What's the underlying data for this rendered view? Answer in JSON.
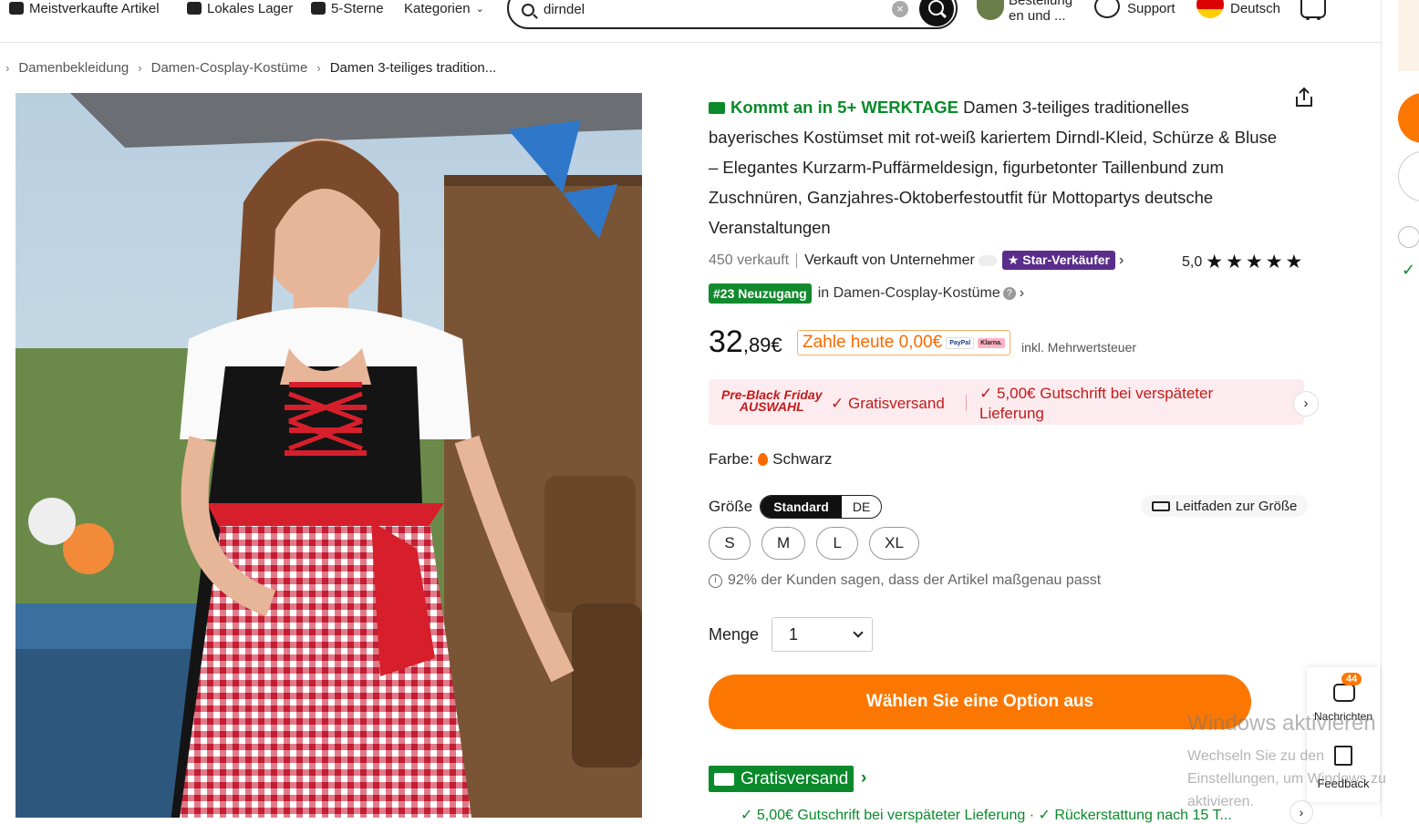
{
  "topnav": {
    "bestsellers": "Meistverkaufte Artikel",
    "local_warehouse": "Lokales Lager",
    "five_stars": "5-Sterne",
    "categories": "Kategorien",
    "order_line1": "Bestellung",
    "order_line2": "en und ...",
    "support": "Support",
    "language": "Deutsch"
  },
  "search": {
    "value": "dirndel",
    "clear": "×"
  },
  "breadcrumb": [
    "Damenbekleidung",
    "Damen-Cosplay-Kostüme",
    "Damen 3-teiliges tradition..."
  ],
  "product": {
    "delivery": "Kommt an in 5+ WERKTAGE",
    "title": "Damen 3-teiliges traditionelles bayerisches Kostümset mit rot-weiß kariertem Dirndl-Kleid, Schürze & Bluse – Elegantes Kurzarm-Puffärmeldesign, figurbetonter Taillenbund zum Zuschnüren, Ganzjahres-Oktoberfestoutfit für Mottopartys deutsche Veranstaltungen",
    "sold": "450 verkauft",
    "seller": "Verkauft von Unternehmer",
    "star_seller": "★ Star-Verkäufer",
    "rating": "5,0",
    "stars": "★★★★★",
    "rank_badge": "#23 Neuzugang",
    "rank_text": "in Damen-Cosplay-Kostüme",
    "price_main": "32",
    "price_cents": ",89€",
    "pay_today": "Zahle heute 0,00€",
    "paypal": "PayPal",
    "klarna": "Klarna.",
    "tax": "inkl. Mehrwertsteuer"
  },
  "promo": {
    "pre_line1": "Pre-Black Friday",
    "pre_line2": "AUSWAHL",
    "free_shipping": "✓ Gratisversand",
    "credit": "✓ 5,00€ Gutschrift bei verspäteter Lieferung"
  },
  "options": {
    "color_label": "Farbe:",
    "color_value": "Schwarz",
    "size_label": "Größe",
    "size_standard": "Standard",
    "size_de": "DE",
    "size_guide": "Leitfaden zur Größe",
    "sizes": [
      "S",
      "M",
      "L",
      "XL"
    ],
    "fit_note": "92% der Kunden sagen, dass der Artikel maßgenau passt",
    "qty_label": "Menge",
    "qty_value": "1",
    "cta": "Wählen Sie eine Option aus"
  },
  "shipping": {
    "badge": "Gratisversand",
    "line": "✓ 5,00€ Gutschrift bei verspäteter Lieferung · ✓ Rückerstattung nach 15 T..."
  },
  "floating": {
    "messages_count": "44",
    "messages": "Nachrichten",
    "feedback": "Feedback"
  },
  "watermark": {
    "line1": "Windows aktivieren",
    "line2": "Wechseln Sie zu den Einstellungen, um Windows zu",
    "line3": "aktivieren."
  },
  "colors": {
    "accent": "#fb7701",
    "green": "#0a8a2a",
    "promo_red": "#c41a1a",
    "star_seller": "#5a2d8a"
  }
}
